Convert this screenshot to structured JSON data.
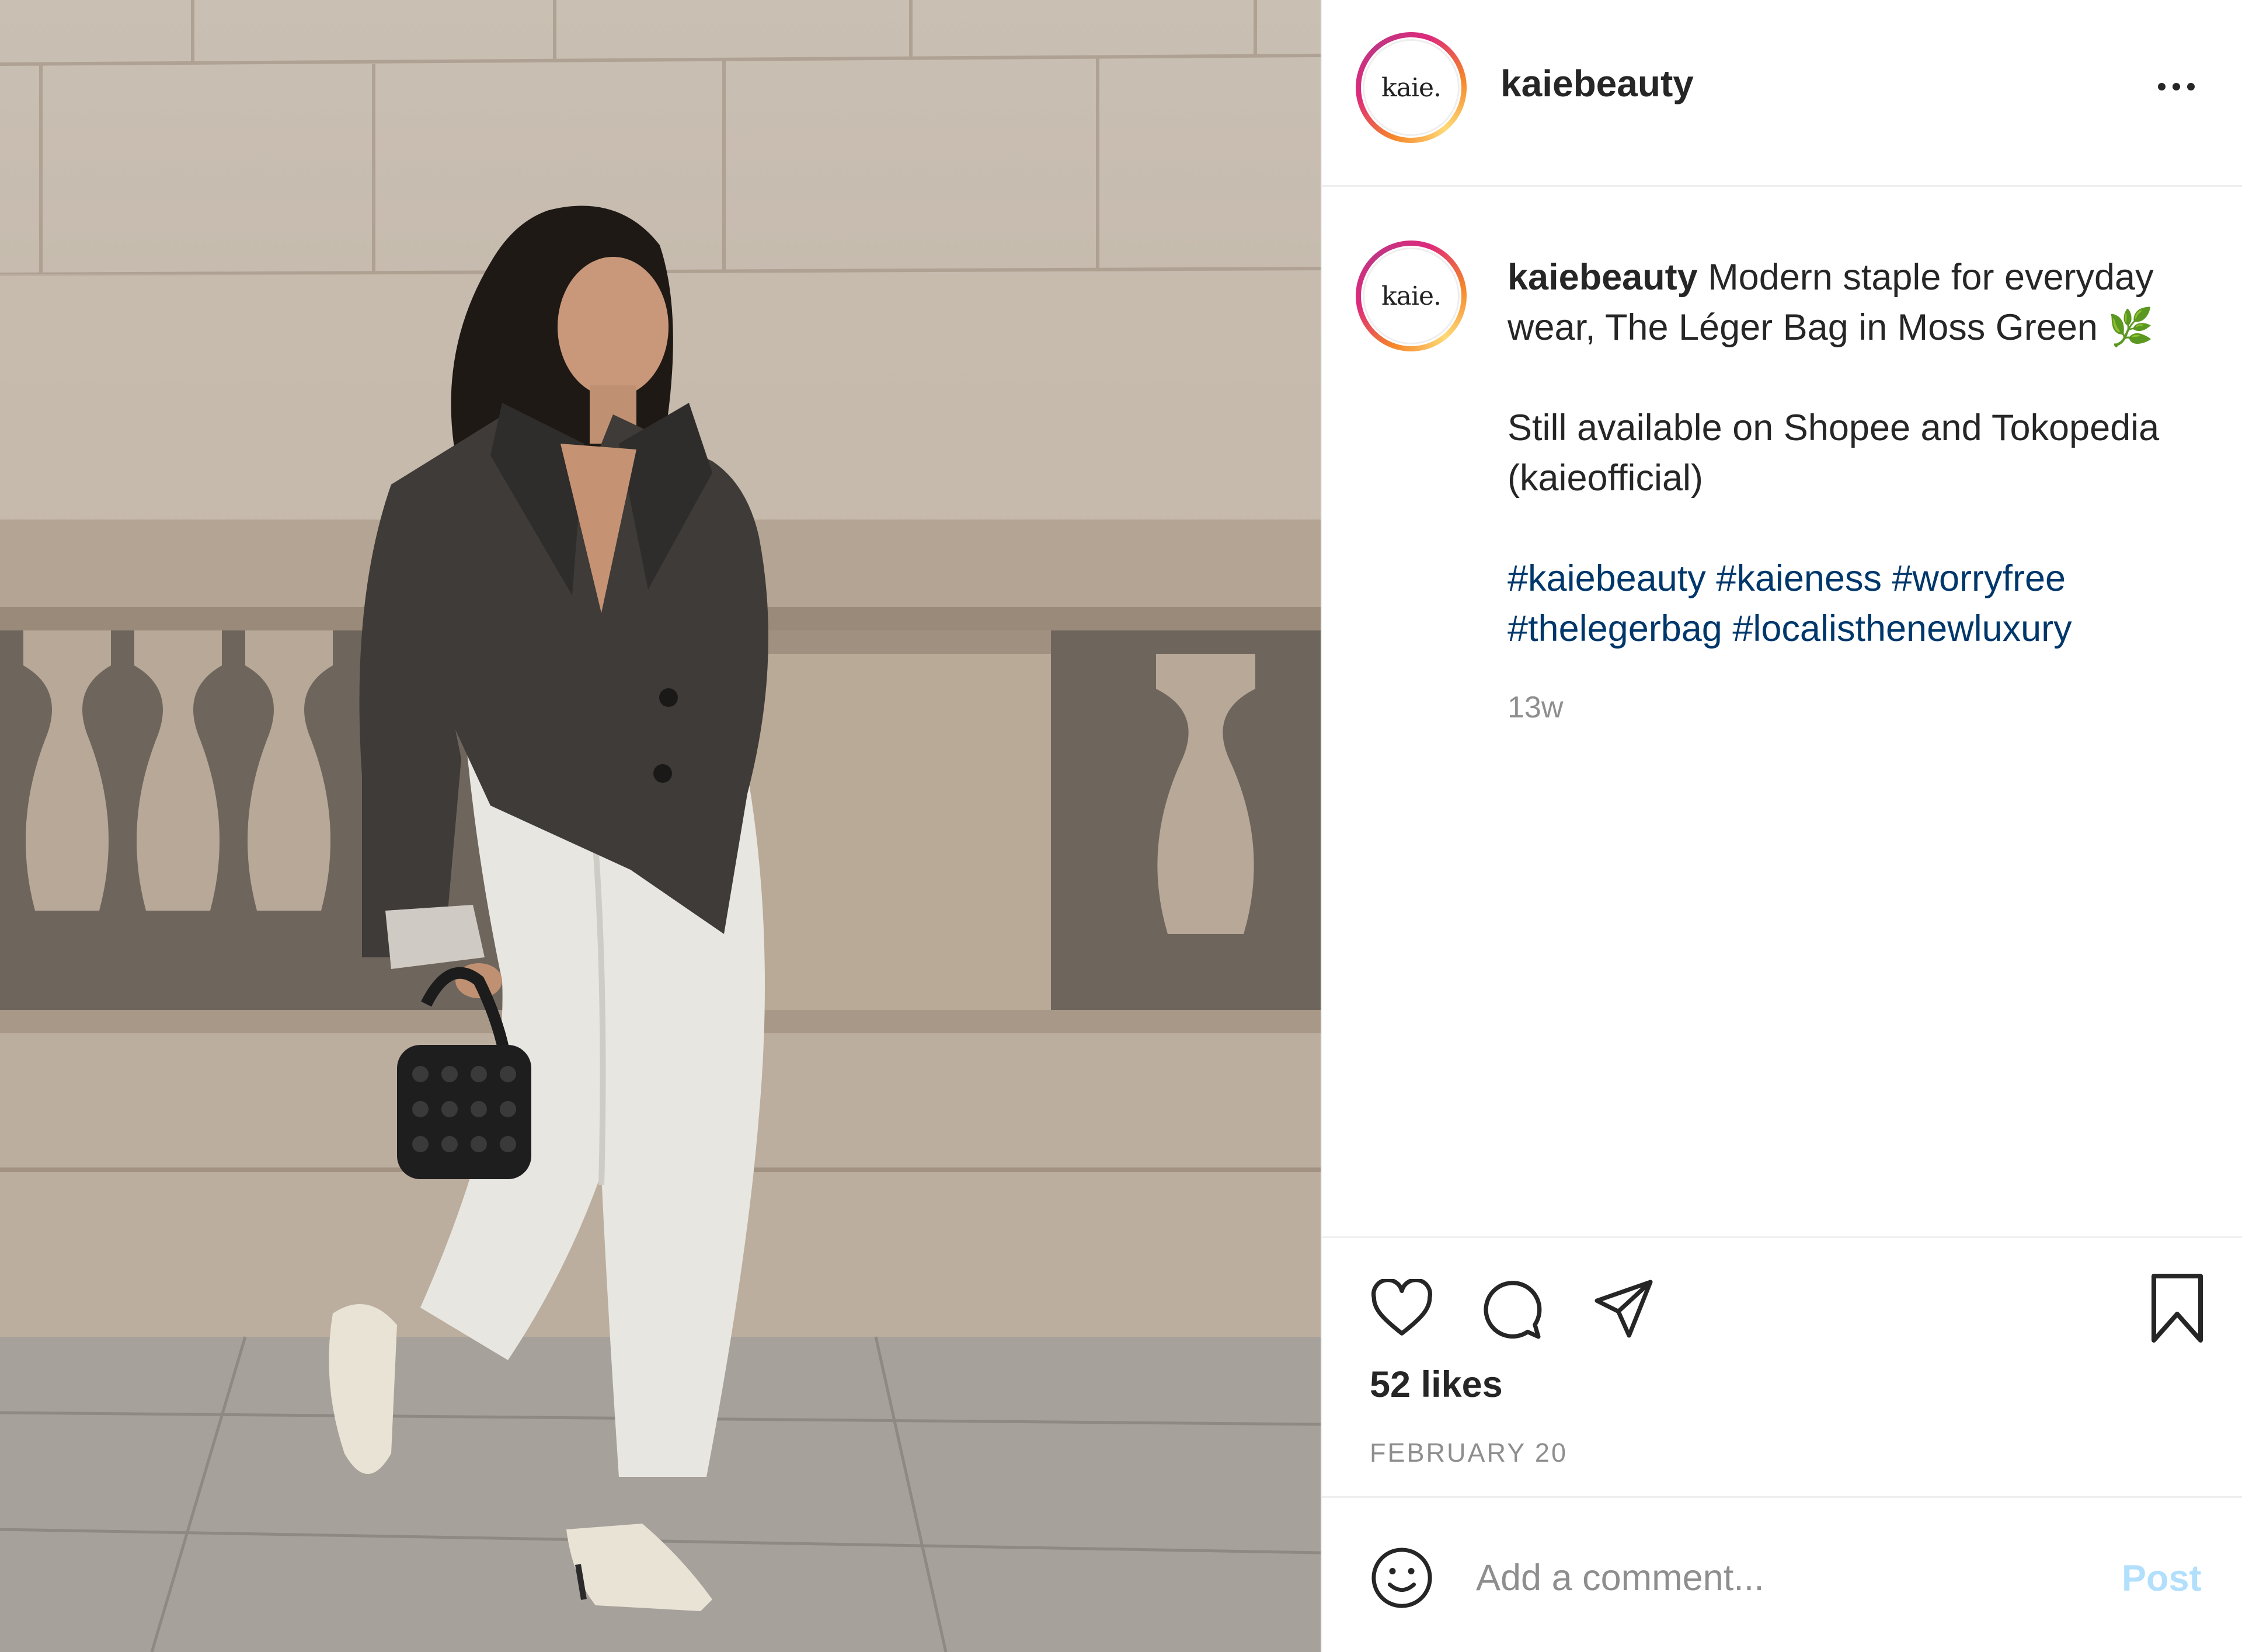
{
  "account": {
    "username": "kaiebeauty",
    "avatar_text": "kaie."
  },
  "caption": {
    "username": "kaiebeauty",
    "line1": "Modern staple for everyday wear, The Léger Bag in Moss Green",
    "emoji": "🌿",
    "line2": "Still available on Shopee and Tokopedia (kaieofficial)",
    "hashtags": [
      "#kaiebeauty",
      "#kaieness",
      "#worryfree",
      "#thelegerbag",
      "#localisthenewluxury"
    ],
    "age": "13w"
  },
  "actions": {
    "icons": [
      "heart-icon",
      "comment-icon",
      "share-icon",
      "bookmark-icon"
    ],
    "likes": "52 likes",
    "date": "FEBRUARY 20"
  },
  "comment": {
    "placeholder": "Add a comment...",
    "post_label": "Post",
    "post_color": "#b2dffc"
  },
  "colors": {
    "ring_gradient": [
      "#f58529",
      "#dd2a7b",
      "#c13584",
      "#feda77"
    ],
    "hashtag": "#00376b",
    "muted": "#8e8e8e",
    "text": "#262626"
  }
}
